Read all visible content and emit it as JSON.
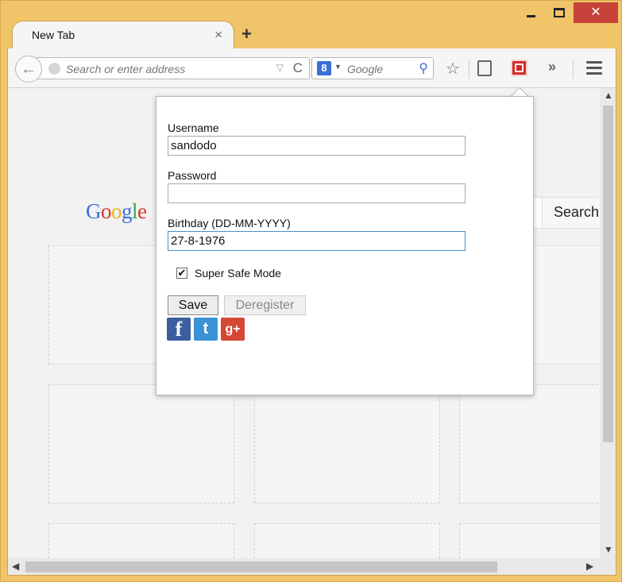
{
  "window": {
    "minimize_glyph": "",
    "close_glyph": "✕"
  },
  "tab": {
    "title": "New Tab",
    "close_glyph": "×",
    "new_tab_glyph": "+"
  },
  "toolbar": {
    "back_glyph": "←",
    "url_placeholder": "Search or enter address",
    "url_dropdown_glyph": "▽",
    "reload_glyph": "C",
    "search_engine_badge": "8",
    "search_engine_dropdown_glyph": "▼",
    "search_placeholder": "Google",
    "search_glyph": "⚲",
    "star_glyph": "☆",
    "overflow_glyph": "»"
  },
  "page": {
    "google_logo_letters": [
      "G",
      "o",
      "o",
      "g",
      "l",
      "e"
    ],
    "search_button_label": "Search"
  },
  "popup": {
    "username_label": "Username",
    "username_value": "sandodo",
    "password_label": "Password",
    "password_value": "",
    "birthday_label": "Birthday (DD-MM-YYYY)",
    "birthday_value": "27-8-1976",
    "safe_mode_label": "Super Safe Mode",
    "safe_mode_checked": true,
    "save_label": "Save",
    "deregister_label": "Deregister",
    "social": {
      "facebook": "f",
      "twitter": "t",
      "googleplus": "g+"
    }
  },
  "scrollbar": {
    "up_glyph": "▲",
    "down_glyph": "▼",
    "left_glyph": "◀",
    "right_glyph": "▶"
  },
  "colors": {
    "frame": "#f0c468",
    "close_button": "#c7423b",
    "accent_blue": "#3b6fd8",
    "extension_red": "#d32b2b"
  }
}
